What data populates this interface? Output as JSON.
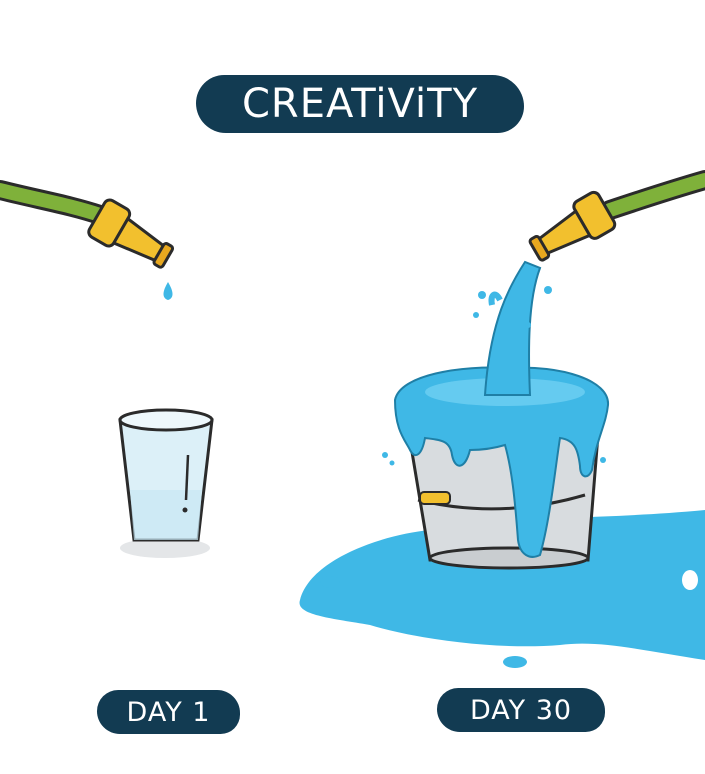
{
  "title": "CREATiViTY",
  "labels": {
    "day_left": "DAY 1",
    "day_right": "DAY 30"
  },
  "colors": {
    "label_bg": "#123b52",
    "label_text": "#ffffff",
    "hose_green": "#7fb13a",
    "nozzle_yellow": "#f2c02e",
    "water_blue": "#3fb8e6",
    "bucket_gray": "#d8dcdf",
    "glass_tint": "#dcf0f8"
  },
  "icons": [
    "hose-left-icon",
    "hose-right-icon",
    "glass-icon",
    "bucket-icon",
    "water-puddle-icon"
  ]
}
